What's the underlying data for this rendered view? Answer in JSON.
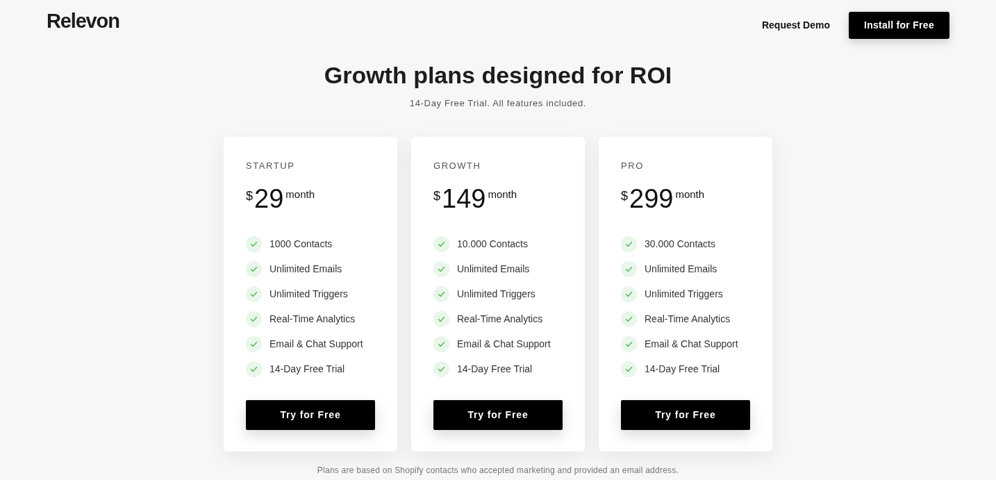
{
  "header": {
    "logo": "Relevon",
    "link": "Request Demo",
    "cta": "Install for Free"
  },
  "hero": {
    "title": "Growth plans designed for ROI",
    "subtitle": "14-Day Free Trial. All features included."
  },
  "plans": [
    {
      "name": "STARTUP",
      "currency": "$",
      "price": "29",
      "period": "month",
      "features": [
        "1000 Contacts",
        "Unlimited Emails",
        "Unlimited Triggers",
        "Real-Time Analytics",
        "Email & Chat Support",
        "14-Day Free Trial"
      ],
      "button": "Try for Free"
    },
    {
      "name": "GROWTH",
      "currency": "$",
      "price": "149",
      "period": "month",
      "features": [
        "10.000 Contacts",
        "Unlimited Emails",
        "Unlimited Triggers",
        "Real-Time Analytics",
        "Email & Chat Support",
        "14-Day Free Trial"
      ],
      "button": "Try for Free"
    },
    {
      "name": "PRO",
      "currency": "$",
      "price": "299",
      "period": "month",
      "features": [
        "30.000 Contacts",
        "Unlimited Emails",
        "Unlimited Triggers",
        "Real-Time Analytics",
        "Email & Chat Support",
        "14-Day Free Trial"
      ],
      "button": "Try for Free"
    }
  ],
  "footnote": "Plans are based on Shopify contacts who accepted marketing and provided an email address."
}
